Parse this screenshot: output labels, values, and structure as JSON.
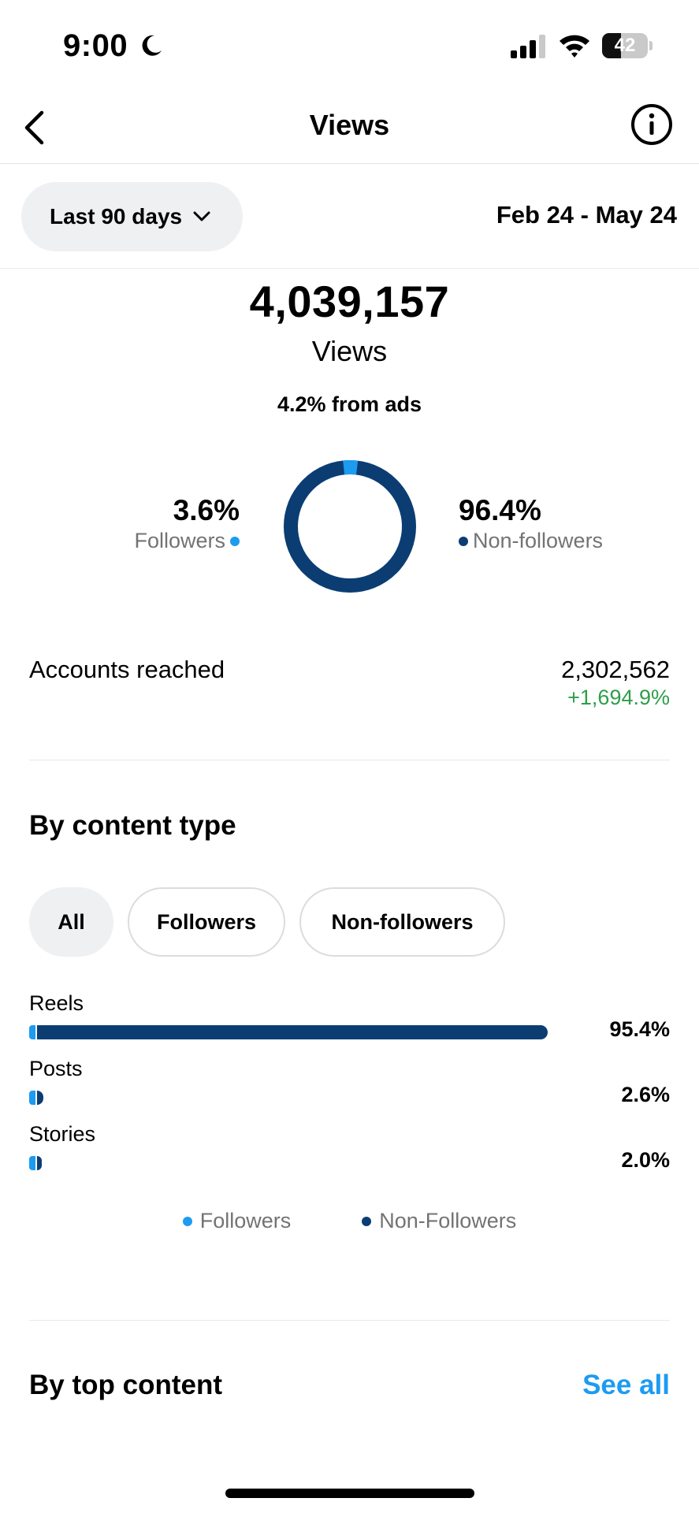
{
  "status_bar": {
    "time": "9:00",
    "battery_level": "42",
    "battery_fraction": 0.42
  },
  "nav": {
    "title": "Views"
  },
  "filter": {
    "period_label": "Last 90 days",
    "date_range": "Feb 24 - May 24"
  },
  "summary": {
    "total": "4,039,157",
    "total_label": "Views",
    "ads_note": "4.2% from ads"
  },
  "split": {
    "followers_pct": "3.6%",
    "followers_label": "Followers",
    "followers_value": 3.6,
    "nonfollowers_pct": "96.4%",
    "nonfollowers_label": "Non-followers",
    "nonfollowers_value": 96.4
  },
  "reach": {
    "label": "Accounts reached",
    "value": "2,302,562",
    "change": "+1,694.9%"
  },
  "content_type": {
    "title": "By content type",
    "chips": [
      "All",
      "Followers",
      "Non-followers"
    ],
    "rows": [
      {
        "label": "Reels",
        "pct": "95.4%",
        "total": 95.4,
        "followers_share": 0.012
      },
      {
        "label": "Posts",
        "pct": "2.6%",
        "total": 2.6,
        "followers_share": 0.4
      },
      {
        "label": "Stories",
        "pct": "2.0%",
        "total": 2.0,
        "followers_share": 0.5
      }
    ],
    "legend": {
      "followers": "Followers",
      "nonfollowers": "Non-Followers"
    }
  },
  "top_content": {
    "title": "By top content",
    "see_all": "See all"
  },
  "colors": {
    "followers": "#1d9bf0",
    "nonfollowers": "#0b3d73",
    "positive": "#2e9e4a",
    "link": "#1d9bf0"
  }
}
